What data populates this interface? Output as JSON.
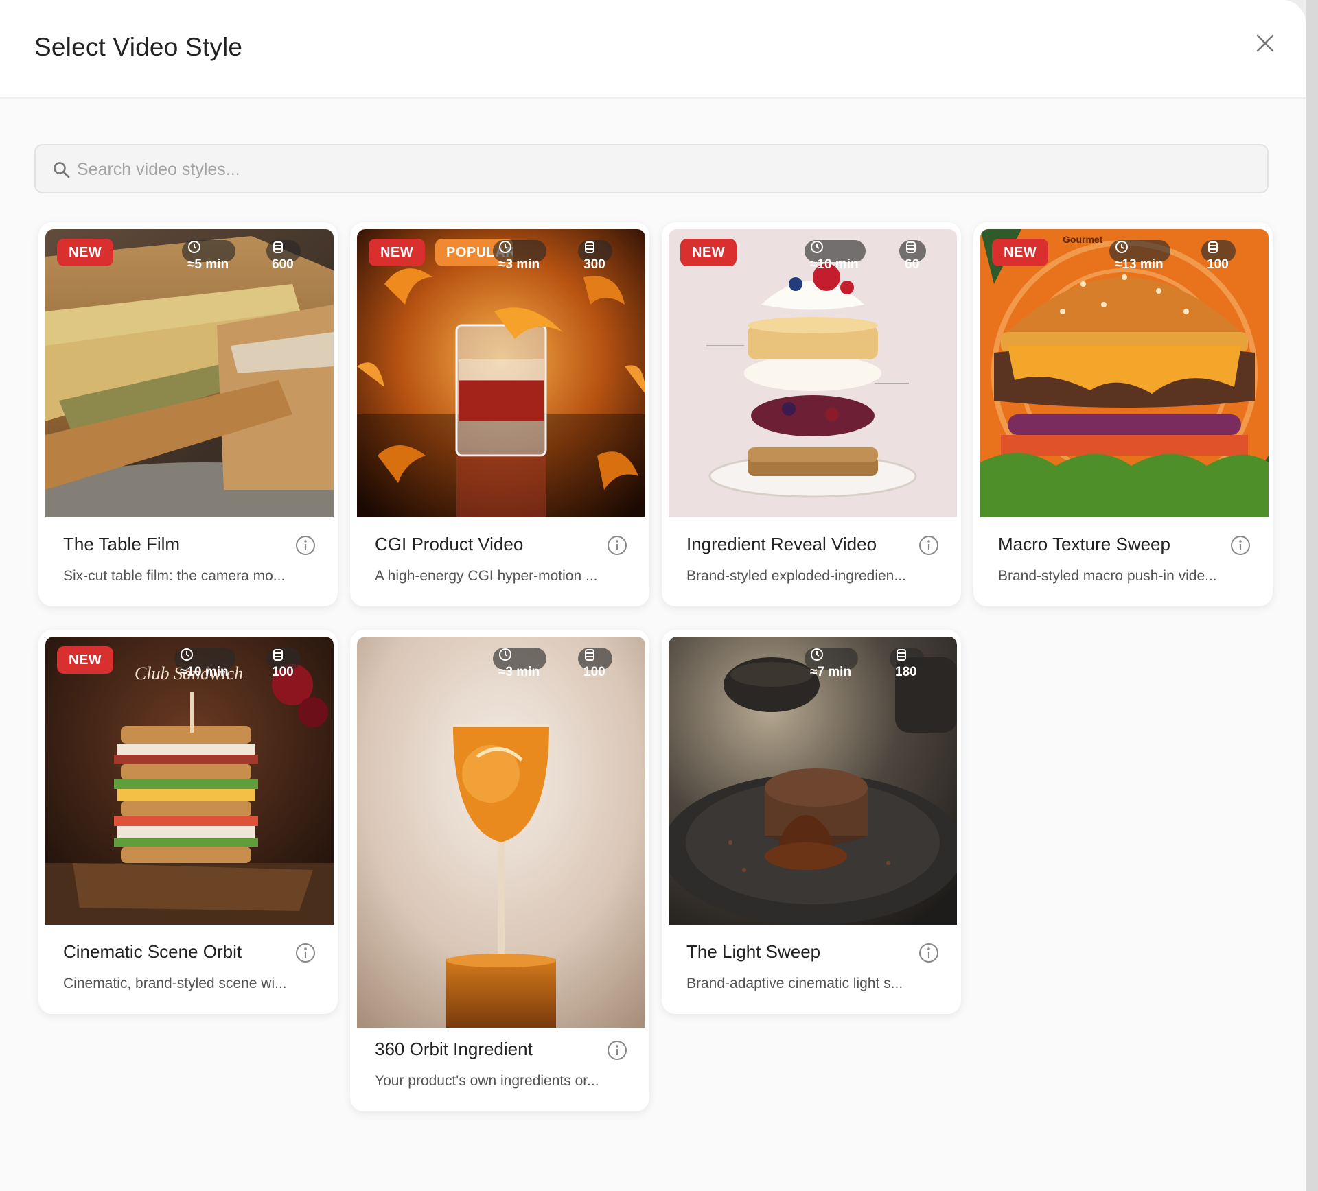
{
  "modal": {
    "title": "Select Video Style"
  },
  "search": {
    "placeholder": "Search video styles..."
  },
  "badges": {
    "new": "NEW",
    "popular": "POPULAR"
  },
  "cards": [
    {
      "title": "The Table Film",
      "description": "Six-cut table film: the camera mo...",
      "duration": "≈5 min",
      "credits": "600"
    },
    {
      "title": "CGI Product Video",
      "description": "A high-energy CGI hyper-motion ...",
      "duration": "≈3 min",
      "credits": "300"
    },
    {
      "title": "Ingredient Reveal Video",
      "description": "Brand-styled exploded-ingredien...",
      "duration": "≈10 min",
      "credits": "60"
    },
    {
      "title": "Macro Texture Sweep",
      "description": "Brand-styled macro push-in vide...",
      "duration": "≈13 min",
      "credits": "100",
      "image_text": "Gourmet"
    },
    {
      "title": "Cinematic Scene Orbit",
      "description": "Cinematic, brand-styled scene wi...",
      "duration": "≈10 min",
      "credits": "100",
      "image_text": "Club Sandwich"
    },
    {
      "title": "360 Orbit Ingredient",
      "description": "Your product's own ingredients or...",
      "duration": "≈3 min",
      "credits": "100"
    },
    {
      "title": "The Light Sweep",
      "description": "Brand-adaptive cinematic light s...",
      "duration": "≈7 min",
      "credits": "180"
    }
  ],
  "colors": {
    "new_badge": "#d92f2f",
    "popular_badge": "#f08a32",
    "meta_pill": "#282828"
  },
  "icons": {
    "close": "close-icon",
    "search": "search-icon",
    "duration": "clock-icon",
    "credits": "coin-stack-icon",
    "info": "info-icon"
  }
}
